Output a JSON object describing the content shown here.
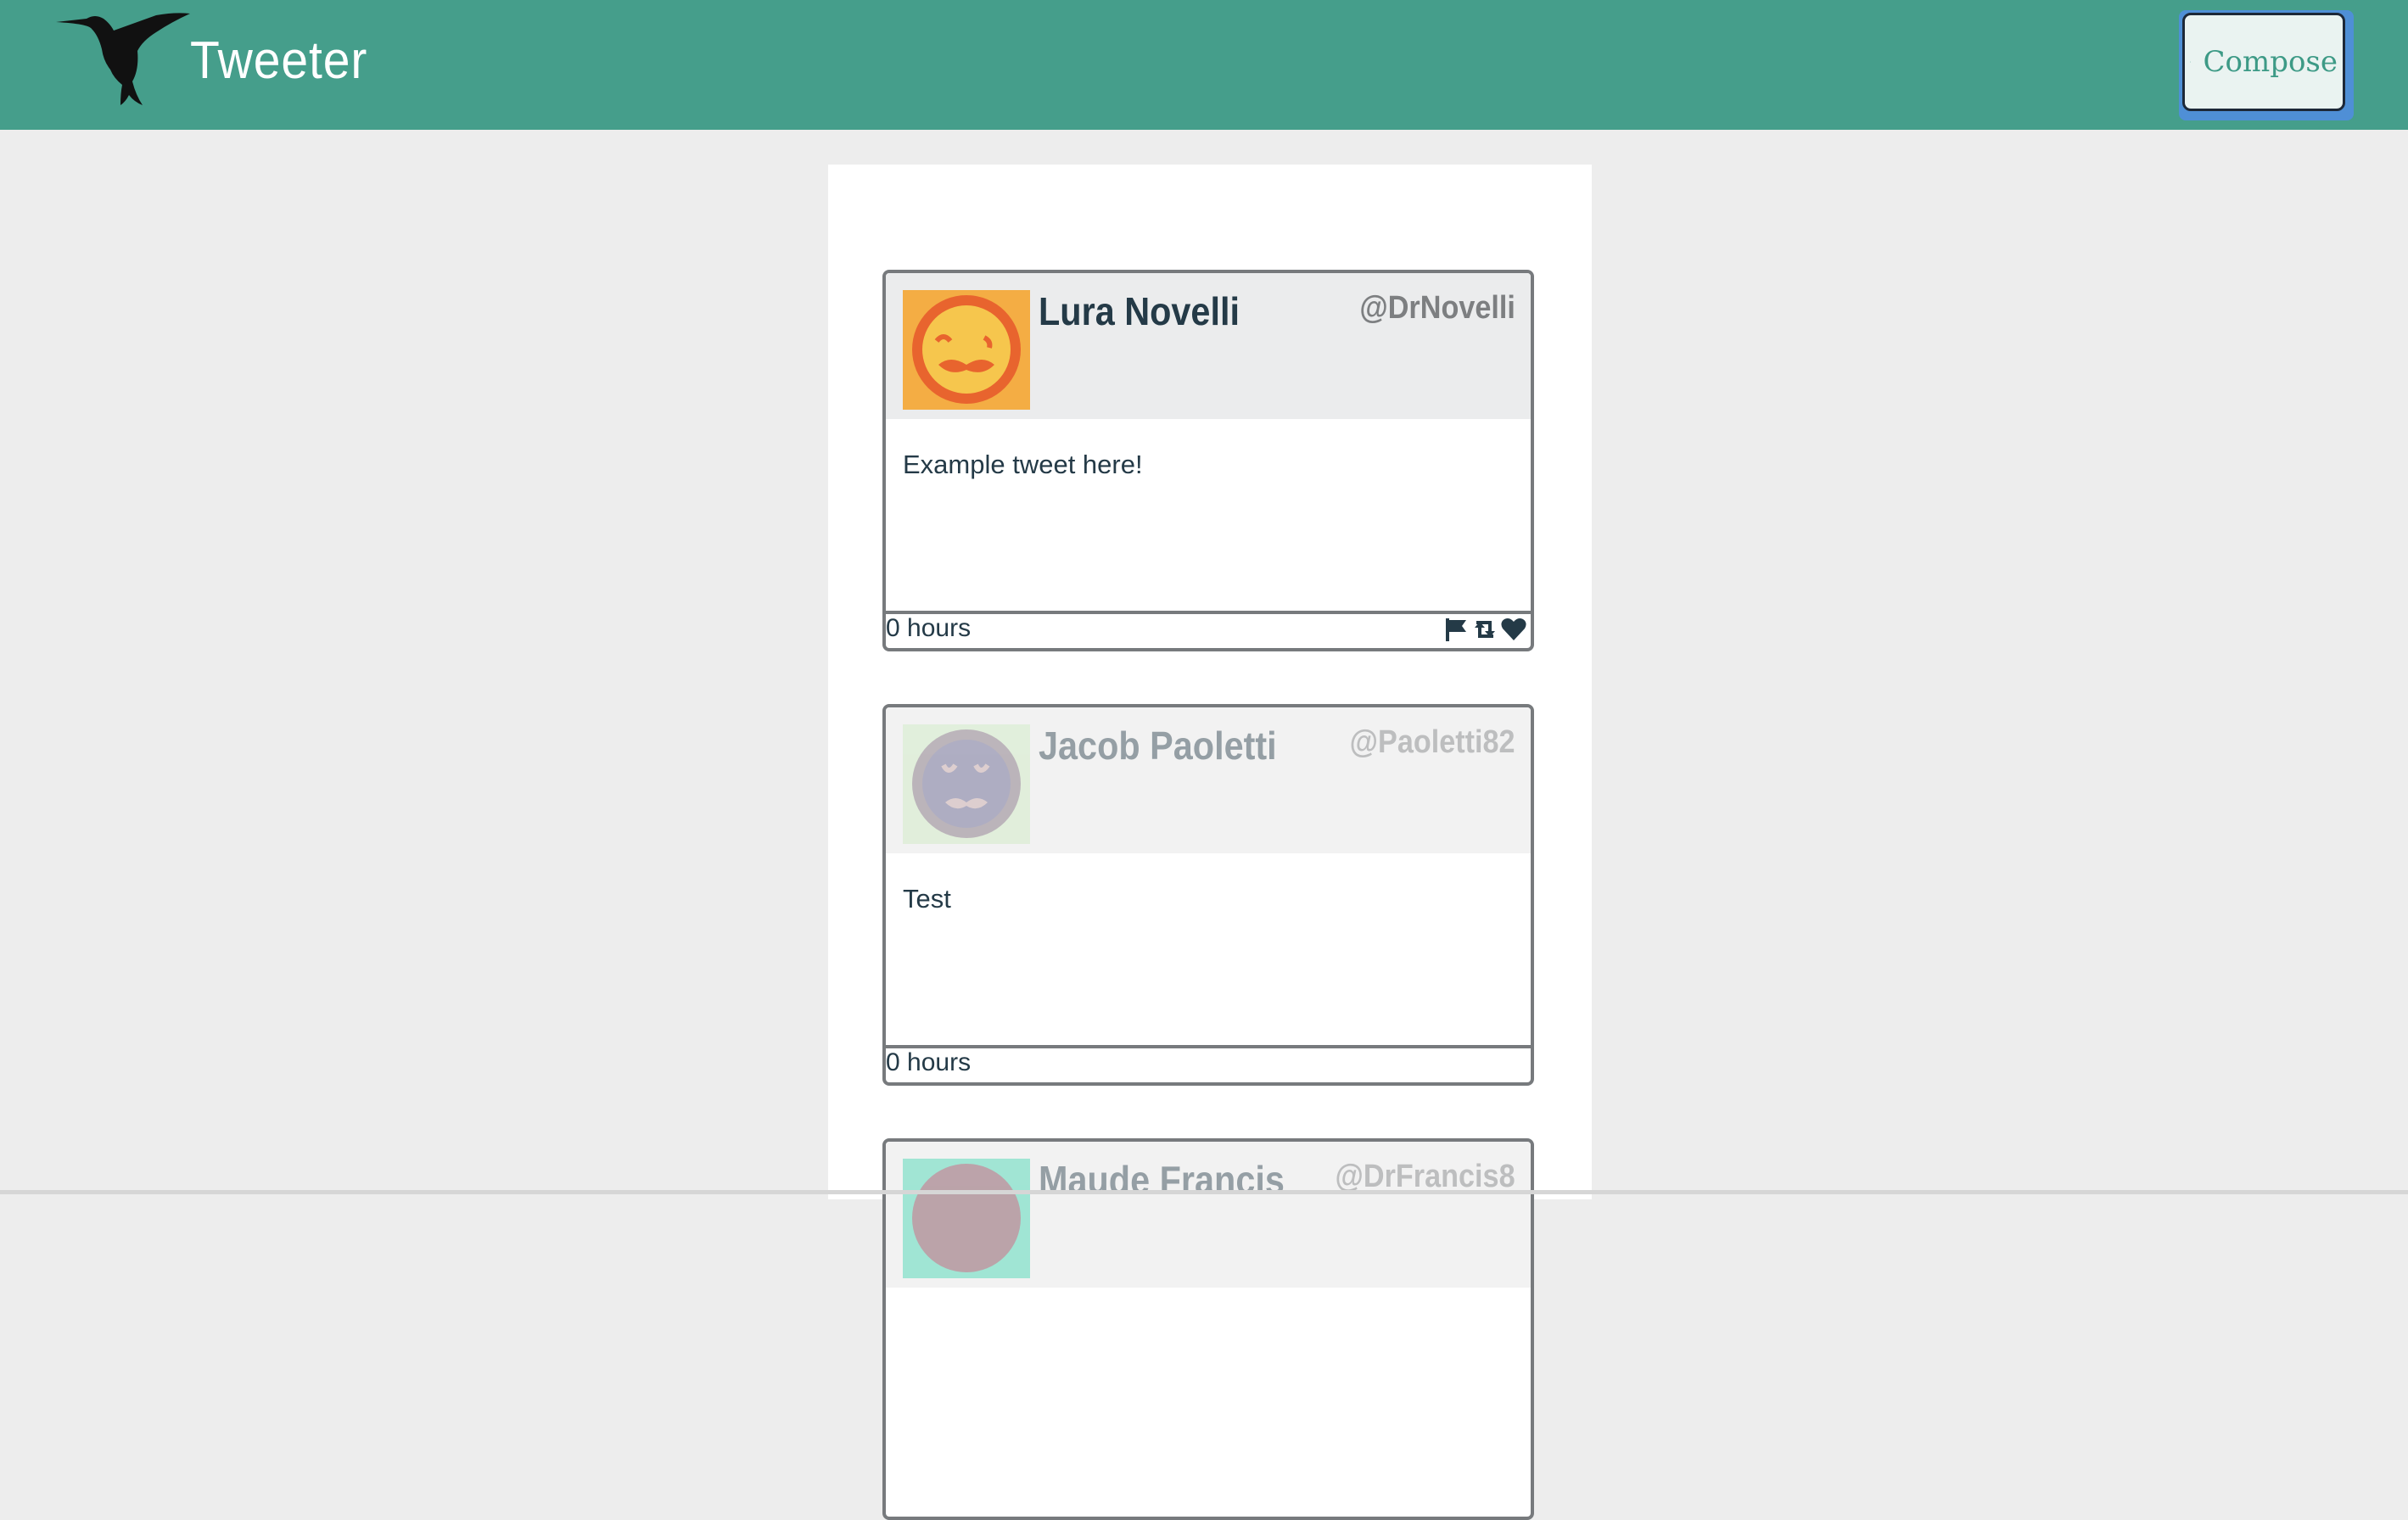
{
  "app": {
    "title": "Tweeter",
    "compose_label": "Compose"
  },
  "colors": {
    "header_bg": "#459e8b",
    "page_bg": "#ededed",
    "text_dark": "#243a47",
    "handle_gray": "#7d7f81"
  },
  "tweets": [
    {
      "name": "Lura Novelli",
      "handle": "@DrNovelli",
      "text": "Example tweet here!",
      "time": "0 hours",
      "avatar": "mustache-face-orange",
      "actions": [
        "flag-icon",
        "retweet-icon",
        "heart-icon"
      ]
    },
    {
      "name": "Jacob Paoletti",
      "handle": "@Paoletti82",
      "text": "Test",
      "time": "0 hours",
      "avatar": "mustache-face-purple"
    },
    {
      "name": "Maude Francis",
      "handle": "@DrFrancis8",
      "avatar": "mustache-face-teal"
    }
  ]
}
